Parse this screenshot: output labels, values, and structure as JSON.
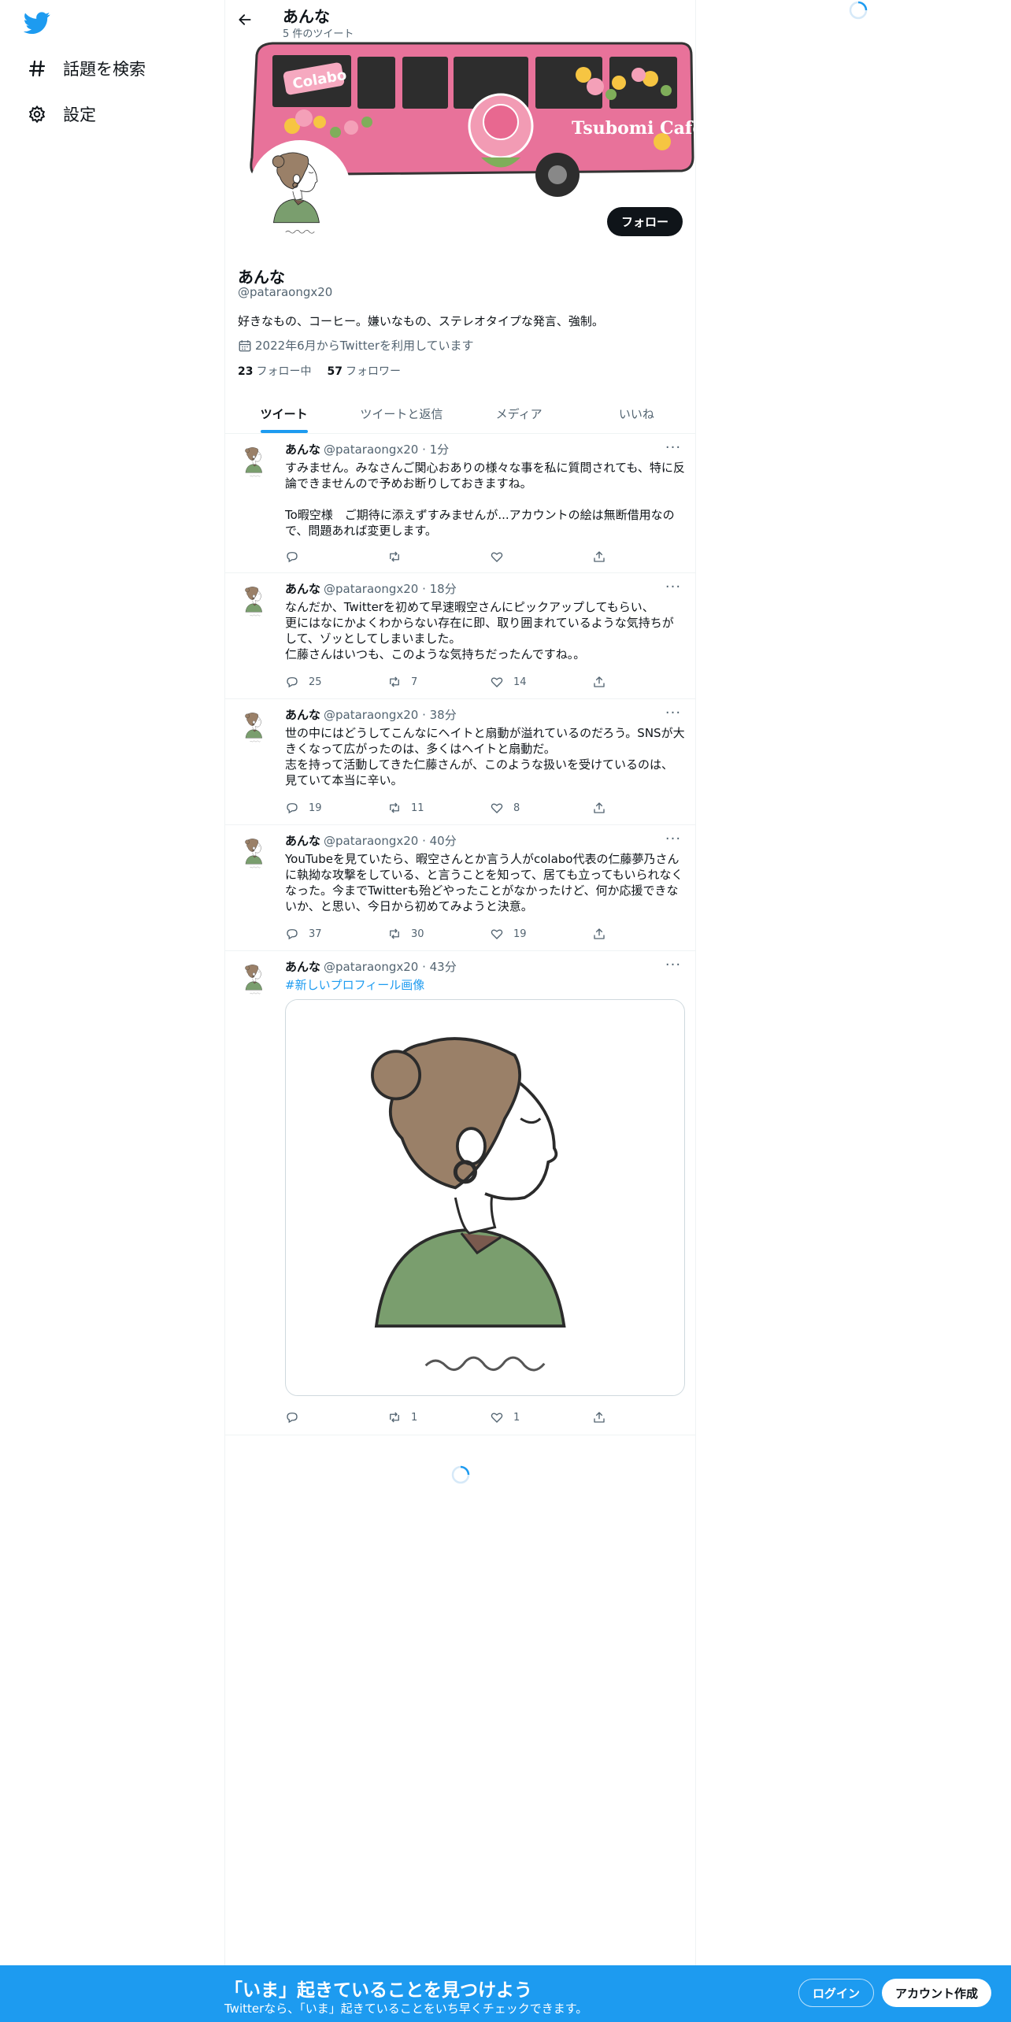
{
  "nav": {
    "explore_label": "話題を検索",
    "settings_label": "設定"
  },
  "header": {
    "name": "あんな",
    "tweet_count": "5 件のツイート"
  },
  "banner": {
    "bus_logo_text": "Colabo",
    "bus_sign_text": "Tsubomi Cafe",
    "bus_color": "#e8729a"
  },
  "profile": {
    "follow_label": "フォロー",
    "name": "あんな",
    "handle": "@pataraongx20",
    "bio": "好きなもの、コーヒー。嫌いなもの、ステレオタイプな発言、強制。",
    "joined": "2022年6月からTwitterを利用しています",
    "following_count": "23",
    "following_label": "フォロー中",
    "followers_count": "57",
    "followers_label": "フォロワー",
    "avatar_signature": "riin"
  },
  "tabs": [
    {
      "label": "ツイート"
    },
    {
      "label": "ツイートと返信"
    },
    {
      "label": "メディア"
    },
    {
      "label": "いいね"
    }
  ],
  "tweets": [
    {
      "name": "あんな",
      "meta": "@pataraongx20 · 1分",
      "text": "すみません。みなさんご関心おありの様々な事を私に質問されても、特に反論できませんので予めお断りしておきますね。\n\nTo暇空様　ご期待に添えずすみませんが...アカウントの絵は無断借用なので、問題あれば変更します。",
      "replies": "",
      "retweets": "",
      "likes": ""
    },
    {
      "name": "あんな",
      "meta": "@pataraongx20 · 18分",
      "text": "なんだか、Twitterを初めて早速暇空さんにピックアップしてもらい、\n更にはなにかよくわからない存在に即、取り囲まれているような気持ちがして、ゾッとしてしまいました。\n仁藤さんはいつも、このような気持ちだったんですね。。",
      "replies": "25",
      "retweets": "7",
      "likes": "14"
    },
    {
      "name": "あんな",
      "meta": "@pataraongx20 · 38分",
      "text": "世の中にはどうしてこんなにヘイトと扇動が溢れているのだろう。SNSが大きくなって広がったのは、多くはヘイトと扇動だ。\n志を持って活動してきた仁藤さんが、このような扱いを受けているのは、見ていて本当に辛い。",
      "replies": "19",
      "retweets": "11",
      "likes": "8"
    },
    {
      "name": "あんな",
      "meta": "@pataraongx20 · 40分",
      "text": "YouTubeを見ていたら、暇空さんとか言う人がcolabo代表の仁藤夢乃さんに執拗な攻撃をしている、と言うことを知って、居ても立ってもいられなくなった。今までTwitterも殆どやったことがなかったけど、何か応援できないか、と思い、今日から初めてみようと決意。",
      "replies": "37",
      "retweets": "30",
      "likes": "19"
    },
    {
      "name": "あんな",
      "meta": "@pataraongx20 · 43分",
      "text": "#新しいプロフィール画像",
      "replies": "",
      "retweets": "1",
      "likes": "1"
    }
  ],
  "bottom": {
    "title": "「いま」起きていることを見つけよう",
    "subtitle": "Twitterなら、「いま」起きていることをいち早くチェックできます。",
    "login_label": "ログイン",
    "signup_label": "アカウント作成"
  },
  "colors": {
    "accent": "#1d9bf0",
    "text": "#0f1419",
    "muted": "#536471"
  }
}
